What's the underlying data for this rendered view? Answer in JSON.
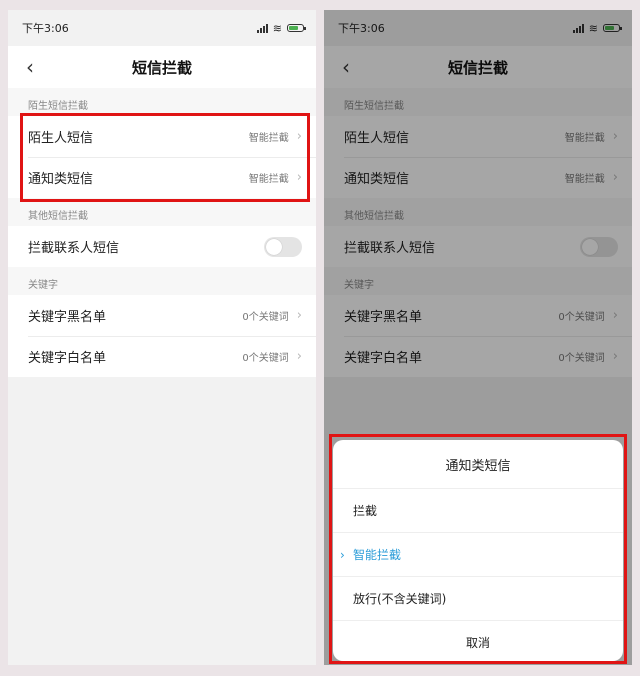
{
  "status_time": "下午3:06",
  "page_title": "短信拦截",
  "sections": {
    "stranger": {
      "header": "陌生短信拦截",
      "items": [
        {
          "label": "陌生人短信",
          "value": "智能拦截"
        },
        {
          "label": "通知类短信",
          "value": "智能拦截"
        }
      ]
    },
    "other": {
      "header": "其他短信拦截",
      "items": [
        {
          "label": "拦截联系人短信",
          "toggle_on": false
        }
      ]
    },
    "keywords": {
      "header": "关键字",
      "items": [
        {
          "label": "关键字黑名单",
          "value": "0个关键词"
        },
        {
          "label": "关键字白名单",
          "value": "0个关键词"
        }
      ]
    }
  },
  "sheet": {
    "title": "通知类短信",
    "options": [
      {
        "label": "拦截",
        "selected": false
      },
      {
        "label": "智能拦截",
        "selected": true
      },
      {
        "label": "放行(不含关键词)",
        "selected": false
      }
    ],
    "cancel": "取消"
  },
  "colors": {
    "highlight": "#e01414",
    "selected": "#2a9cd8",
    "battery": "#4caf50"
  }
}
